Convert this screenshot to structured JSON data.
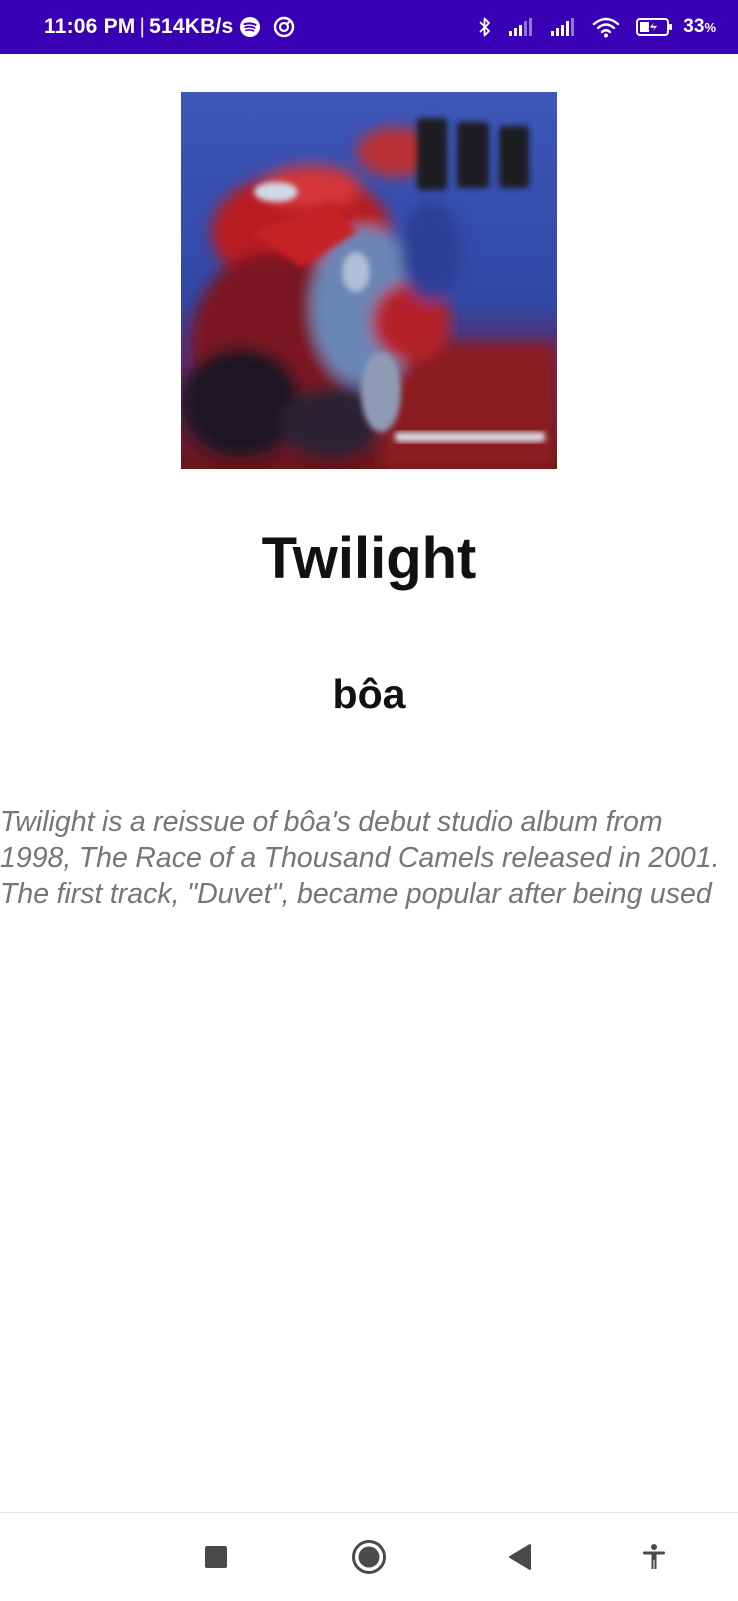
{
  "status_bar": {
    "time": "11:06 PM",
    "separator": "|",
    "network_speed": "514KB/s",
    "battery_percent": "33",
    "battery_unit": "%",
    "left_icons": [
      "spotify-icon",
      "sync-icon"
    ],
    "right_icons": [
      "bluetooth-icon",
      "signal-icon",
      "signal-icon",
      "wifi-icon",
      "battery-charging-icon"
    ],
    "background_color": "#3a00b6"
  },
  "album": {
    "title": "Twilight",
    "artist": "bôa",
    "description": "Twilight is a reissue of bôa's debut studio album from 1998, The Race of a Thousand Camels released in 2001. The first track, \"Duvet\", became popular after being used as the opening theme song for the anime series Serial Experiments Lain."
  },
  "nav_bar": {
    "buttons": [
      "recents-square-icon",
      "home-circle-icon",
      "back-triangle-icon",
      "accessibility-icon"
    ]
  }
}
